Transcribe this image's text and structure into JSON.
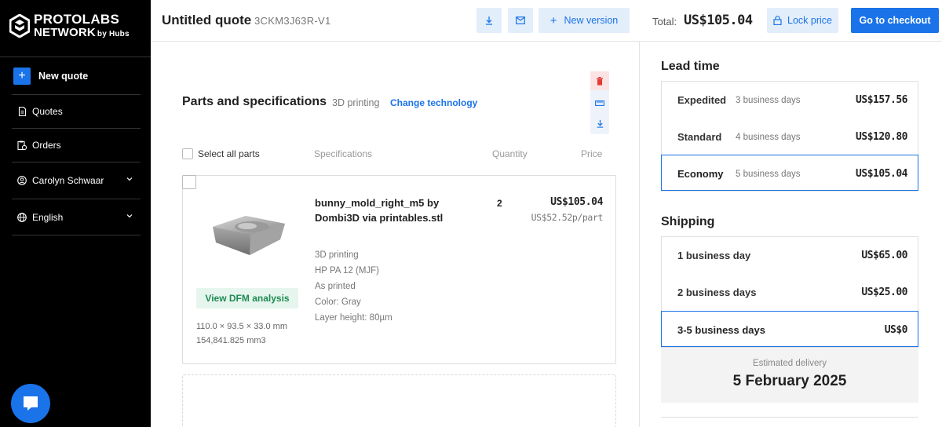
{
  "brand": {
    "line1": "PROTOLABS",
    "line2": "NETWORK",
    "by": "by Hubs"
  },
  "sidebar": {
    "new_quote": "New quote",
    "items": [
      {
        "label": "Quotes",
        "icon": "document-icon"
      },
      {
        "label": "Orders",
        "icon": "clipboard-icon"
      },
      {
        "label": "Carolyn Schwaar",
        "icon": "user-circle-icon",
        "has_chevron": true
      },
      {
        "label": "English",
        "icon": "globe-icon",
        "has_chevron": true
      }
    ]
  },
  "header": {
    "title": "Untitled quote",
    "quote_id": "3CKM3J63R-V1",
    "new_version": "New version",
    "total_label": "Total:",
    "total_value": "US$105.04",
    "lock_price": "Lock price",
    "checkout": "Go to checkout"
  },
  "parts": {
    "title": "Parts and specifications",
    "technology": "3D printing",
    "change_technology": "Change technology",
    "select_all": "Select all parts",
    "columns": {
      "specifications": "Specifications",
      "quantity": "Quantity",
      "price": "Price"
    },
    "items": [
      {
        "name": "bunny_mold_right_m5 by Dombi3D via printables.stl",
        "quantity": "2",
        "price": "US$105.04",
        "unit_price": "US$52.52p/part",
        "specs": [
          "3D printing",
          "HP PA 12 (MJF)",
          "As printed",
          "Color: Gray",
          "Layer height: 80µm"
        ],
        "dfm_button": "View DFM analysis",
        "dimensions": "110.0 × 93.5 × 33.0 mm",
        "volume": "154,841.825 mm3"
      }
    ]
  },
  "lead_time": {
    "title": "Lead time",
    "options": [
      {
        "label": "Expedited",
        "days": "3 business days",
        "price": "US$157.56",
        "selected": false
      },
      {
        "label": "Standard",
        "days": "4 business days",
        "price": "US$120.80",
        "selected": false
      },
      {
        "label": "Economy",
        "days": "5 business days",
        "price": "US$105.04",
        "selected": true
      }
    ]
  },
  "shipping": {
    "title": "Shipping",
    "options": [
      {
        "label": "1 business day",
        "price": "US$65.00",
        "selected": false
      },
      {
        "label": "2 business days",
        "price": "US$25.00",
        "selected": false
      },
      {
        "label": "3-5 business days",
        "price": "US$0",
        "selected": true
      }
    ],
    "estimated_label": "Estimated delivery",
    "estimated_date": "5 February 2025"
  },
  "colors": {
    "accent": "#1a73e8",
    "sidebar_bg": "#000000",
    "dfm_green": "#1e8a53",
    "delete_red": "#e53935"
  }
}
